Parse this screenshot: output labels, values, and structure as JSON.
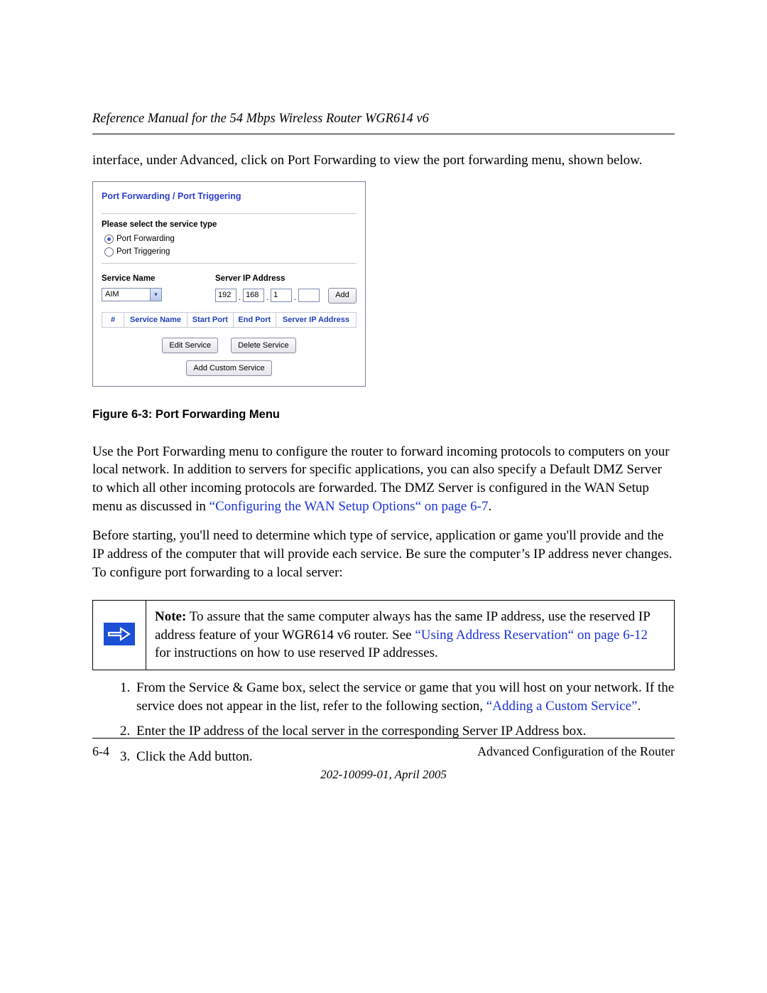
{
  "header": {
    "title": "Reference Manual for the 54 Mbps Wireless Router WGR614 v6"
  },
  "intro_para": "interface, under Advanced, click on Port Forwarding to view the port forwarding menu, shown below.",
  "screenshot": {
    "title": "Port Forwarding / Port Triggering",
    "select_label": "Please select the service type",
    "radio1": "Port Forwarding",
    "radio2": "Port Triggering",
    "service_name_label": "Service Name",
    "server_ip_label": "Server IP Address",
    "service_value": "AIM",
    "ip": {
      "a": "192",
      "b": "168",
      "c": "1",
      "d": ""
    },
    "add_btn": "Add",
    "table": {
      "col_num": "#",
      "col_service": "Service Name",
      "col_start": "Start Port",
      "col_end": "End Port",
      "col_ip": "Server IP Address"
    },
    "btn_edit": "Edit Service",
    "btn_delete": "Delete Service",
    "btn_custom": "Add Custom Service"
  },
  "figure_caption": "Figure 6-3:  Port Forwarding Menu",
  "para2_a": "Use the Port Forwarding menu to configure the router to forward incoming protocols to computers on your local network. In addition to servers for specific applications, you can also specify a Default DMZ Server to which all other incoming protocols are forwarded. The DMZ Server is configured in the WAN Setup menu as discussed in ",
  "para2_link": "“Configuring the WAN Setup Options“ on page 6-7",
  "para2_b": ".",
  "para3": "Before starting, you'll need to determine which type of service, application or game you'll provide and the IP address of the computer that will provide each service. Be sure the computer’s IP address never changes. To configure port forwarding to a local server:",
  "note": {
    "bold": "Note:",
    "text_a": " To assure that the same computer always has the same IP address, use the reserved IP address feature of your WGR614 v6 router. See ",
    "link": "“Using Address Reservation“ on page 6-12",
    "text_b": " for instructions on how to use reserved IP addresses."
  },
  "steps": {
    "s1_a": "From the Service & Game box, select the service or game that you will host on your network. If the service does not appear in the list, refer to the following section, ",
    "s1_link": "“Adding a Custom Service”",
    "s1_b": ".",
    "s2": "Enter the IP address of the local server in the corresponding Server IP Address box.",
    "s3": "Click the Add button."
  },
  "footer": {
    "page_num": "6-4",
    "section": "Advanced Configuration of the Router",
    "docnum": "202-10099-01, April 2005"
  }
}
